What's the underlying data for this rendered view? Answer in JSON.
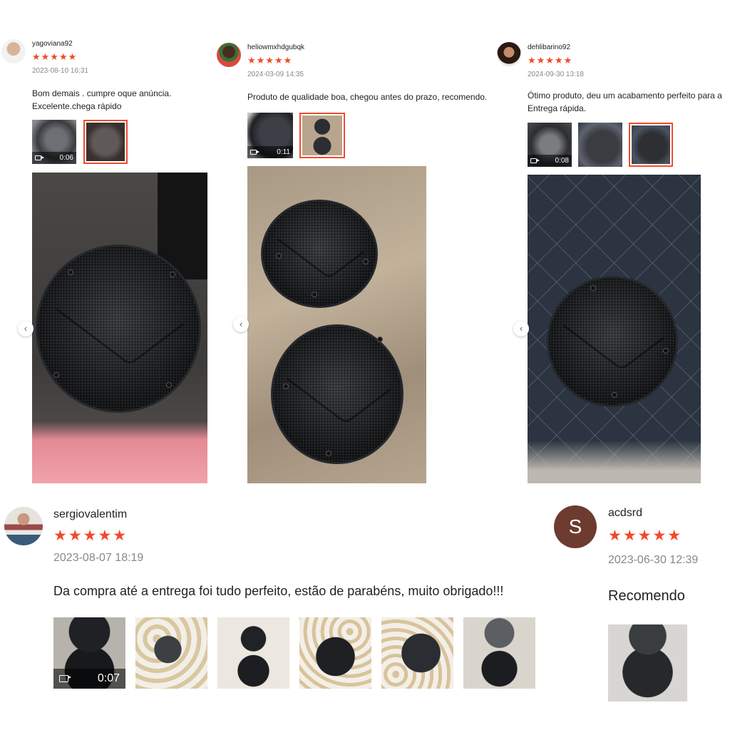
{
  "reviews_top": [
    {
      "username": "yagoviana92",
      "stars": "★★★★★",
      "date": "2023-08-10 16:31",
      "text_lines": [
        "Bom demais . cumpre oque anúncia.",
        "Excelente.chega rápido"
      ],
      "video_duration": "0:06"
    },
    {
      "username": "heliowmxhdgubqk",
      "stars": "★★★★★",
      "date": "2024-03-09 14:35",
      "text_lines": [
        "Produto de qualidade boa, chegou antes do prazo, recomendo."
      ],
      "video_duration": "0:11"
    },
    {
      "username": "dehlibarino92",
      "stars": "★★★★★",
      "date": "2024-09-30 13:18",
      "text_lines": [
        "Ótimo produto, deu um acabamento perfeito para a",
        "Entrega rápida."
      ],
      "video_duration": "0:08"
    }
  ],
  "review_bottom_left": {
    "username": "sergiovalentim",
    "stars": "★★★★★",
    "date": "2023-08-07 18:19",
    "text": "Da compra até a entrega foi tudo perfeito, estão de parabéns, muito obrigado!!!",
    "video_duration": "0:07"
  },
  "review_bottom_right": {
    "avatar_letter": "S",
    "username": "acdsrd",
    "stars": "★★★★★",
    "date": "2023-06-30 12:39",
    "text": "Recomendo"
  },
  "nav_prev_glyph": "‹",
  "colors": {
    "star": "#f04a2a",
    "selected_border": "#ee4d2d",
    "avatar_s": "#6d3b2f"
  },
  "icons": [
    "video-camera-icon",
    "chevron-left-icon",
    "star-icon"
  ]
}
